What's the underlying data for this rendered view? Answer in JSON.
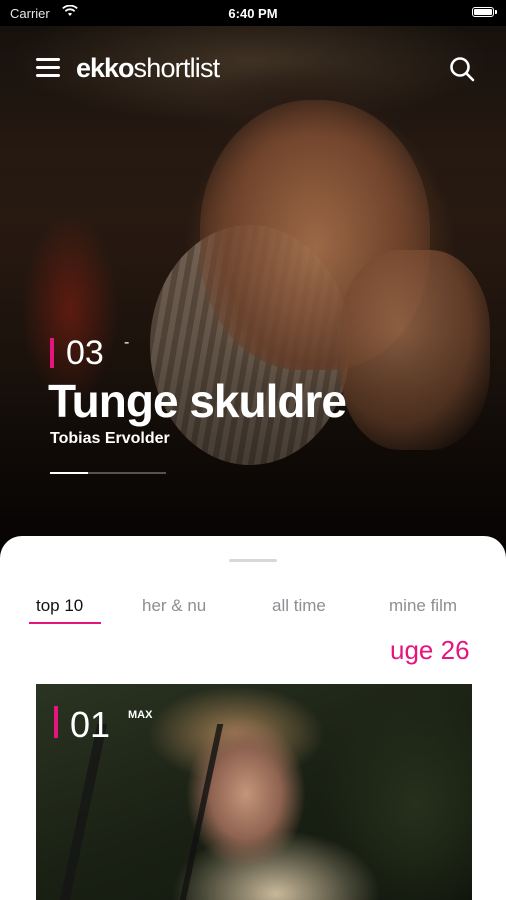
{
  "status_bar": {
    "carrier": "Carrier",
    "time": "6:40 PM"
  },
  "header": {
    "logo_brand": "ekko",
    "logo_sub": "shortlist"
  },
  "hero": {
    "rank": "03",
    "rank_suffix": "-",
    "title": "Tunge skuldre",
    "director": "Tobias Ervolder",
    "carousel_progress": 0.33
  },
  "tabs": [
    {
      "label": "top 10",
      "active": true
    },
    {
      "label": "her & nu",
      "active": false
    },
    {
      "label": "all time",
      "active": false
    },
    {
      "label": "mine film",
      "active": false
    }
  ],
  "week_label": "uge 26",
  "films": [
    {
      "rank": "01",
      "tag": "MAX"
    }
  ],
  "colors": {
    "accent": "#e6157e",
    "sheet_bg": "#ffffff",
    "tab_inactive": "#8e8e93"
  },
  "icons": {
    "menu": "hamburger-icon",
    "search": "search-icon",
    "wifi": "wifi-icon",
    "battery": "battery-icon"
  }
}
